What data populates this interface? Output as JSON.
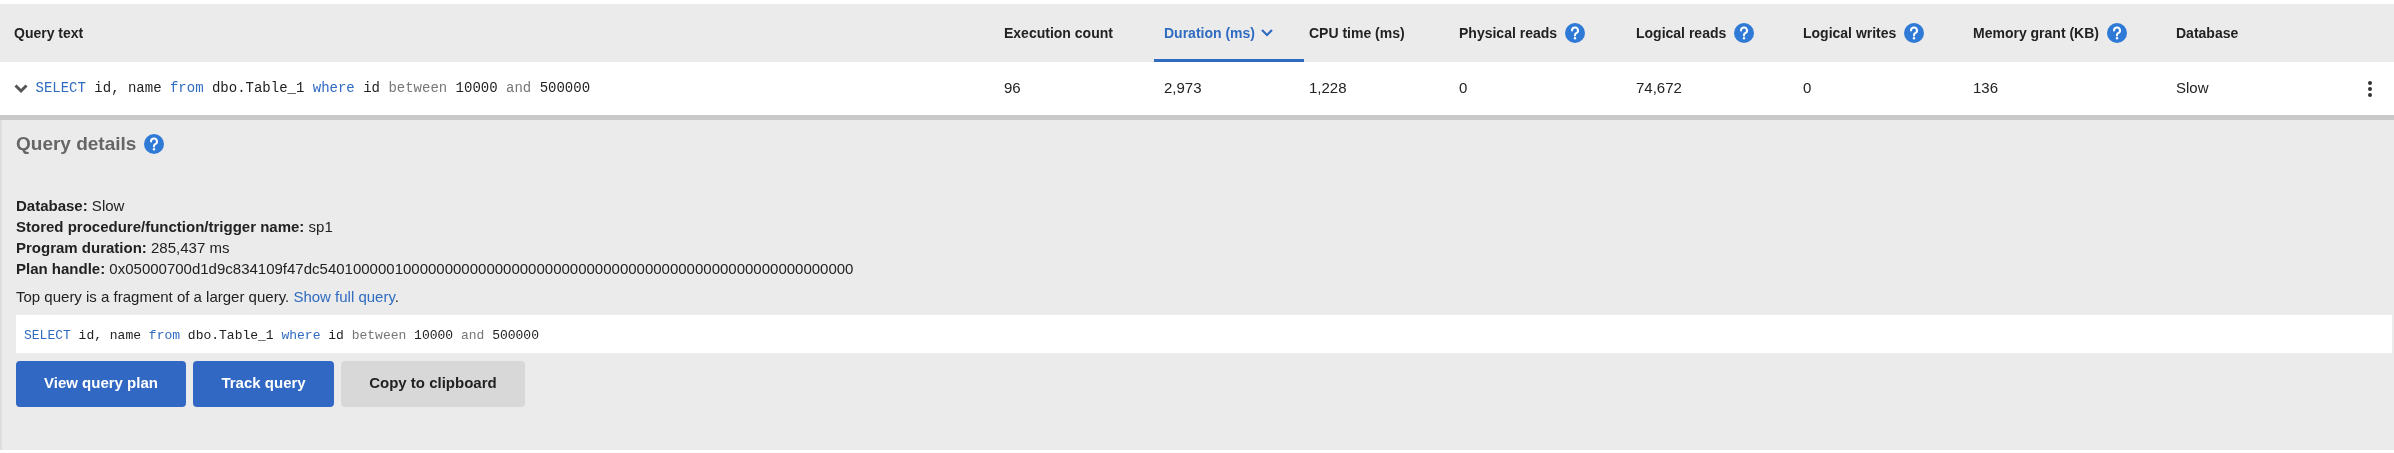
{
  "table": {
    "query_column": {
      "label": "Query text",
      "sorted": false,
      "help": false
    },
    "columns": [
      {
        "label": "Execution count",
        "sorted": false,
        "help": false
      },
      {
        "label": "Duration (ms)",
        "sorted": true,
        "help": false
      },
      {
        "label": "CPU time (ms)",
        "sorted": false,
        "help": false
      },
      {
        "label": "Physical reads",
        "sorted": false,
        "help": true
      },
      {
        "label": "Logical reads",
        "sorted": false,
        "help": true
      },
      {
        "label": "Logical writes",
        "sorted": false,
        "help": true
      },
      {
        "label": "Memory grant (KB)",
        "sorted": false,
        "help": true
      },
      {
        "label": "Database",
        "sorted": false,
        "help": false
      }
    ],
    "rows": [
      {
        "expanded": true,
        "query": [
          {
            "text": "SELECT",
            "kind": "keyword"
          },
          {
            "text": " id, name ",
            "kind": "plain"
          },
          {
            "text": "from",
            "kind": "keyword"
          },
          {
            "text": " dbo.Table_1 ",
            "kind": "plain"
          },
          {
            "text": "where",
            "kind": "keyword"
          },
          {
            "text": " id ",
            "kind": "plain"
          },
          {
            "text": "between",
            "kind": "operator"
          },
          {
            "text": " 10000 ",
            "kind": "plain"
          },
          {
            "text": "and",
            "kind": "operator"
          },
          {
            "text": " 500000",
            "kind": "plain"
          }
        ],
        "cells": [
          "96",
          "2,973",
          "1,228",
          "0",
          "74,672",
          "0",
          "136",
          "Slow"
        ]
      }
    ]
  },
  "details": {
    "title": "Query details",
    "fields": [
      "**Database:** Slow",
      "**Stored procedure/function/trigger name:** sp1",
      "**Program duration:** 285,437 ms",
      "**Plan handle:** 0x05000700d1d9c834109f47dc5401000001000000000000000000000000000000000000000000000000000000"
    ],
    "note": "Top query is a fragment of a larger query.",
    "link": "Show full query",
    "note_end": ".",
    "query": [
      {
        "text": "SELECT",
        "kind": "keyword"
      },
      {
        "text": " id, name ",
        "kind": "plain"
      },
      {
        "text": "from",
        "kind": "keyword"
      },
      {
        "text": " dbo.Table_1 ",
        "kind": "plain"
      },
      {
        "text": "where",
        "kind": "keyword"
      },
      {
        "text": " id ",
        "kind": "plain"
      },
      {
        "text": "between",
        "kind": "operator"
      },
      {
        "text": " 10000 ",
        "kind": "plain"
      },
      {
        "text": "and",
        "kind": "operator"
      },
      {
        "text": " 500000",
        "kind": "plain"
      }
    ],
    "buttons": [
      {
        "label": "View query plan",
        "kind": "primary"
      },
      {
        "label": "Track query",
        "kind": "primary"
      },
      {
        "label": "Copy to clipboard",
        "kind": "secondary"
      }
    ]
  }
}
